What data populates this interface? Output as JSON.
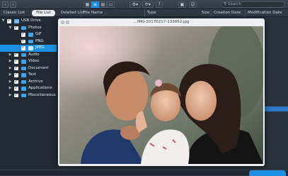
{
  "toolbar": {
    "back_icon": "chevron-left",
    "forward_icon": "chevron-right",
    "views": [
      "▦",
      "≡",
      "▤",
      "▭"
    ],
    "settings_glyph": "⚙▾",
    "refresh_glyph": "⟳▾",
    "help_glyph": "?",
    "cart_glyph": "🛒",
    "account_glyph": "☺",
    "search_placeholder": "Search"
  },
  "tabs": [
    {
      "label": "Classic List"
    },
    {
      "label": "File List"
    },
    {
      "label": "Deleted List"
    }
  ],
  "columns": [
    "File Name",
    "Type",
    "Size",
    "Creation Date",
    "Modification Date"
  ],
  "tree": [
    {
      "label": "USB Drive",
      "expanded": true
    },
    {
      "label": "Photos",
      "expanded": true
    },
    {
      "label": "GIF"
    },
    {
      "label": "PNG"
    },
    {
      "label": "JPEG",
      "selected": true
    },
    {
      "label": "Audio"
    },
    {
      "label": "Video"
    },
    {
      "label": "Document"
    },
    {
      "label": "Text"
    },
    {
      "label": "Archive"
    },
    {
      "label": "Applications"
    },
    {
      "label": "Miscellaneous"
    }
  ],
  "preview": {
    "title": "...IMG-20170217-133052.jpg"
  },
  "colors": {
    "accent": "#1d8fe0",
    "sidebar_bg": "#222a33",
    "app_bg": "#27303b"
  }
}
